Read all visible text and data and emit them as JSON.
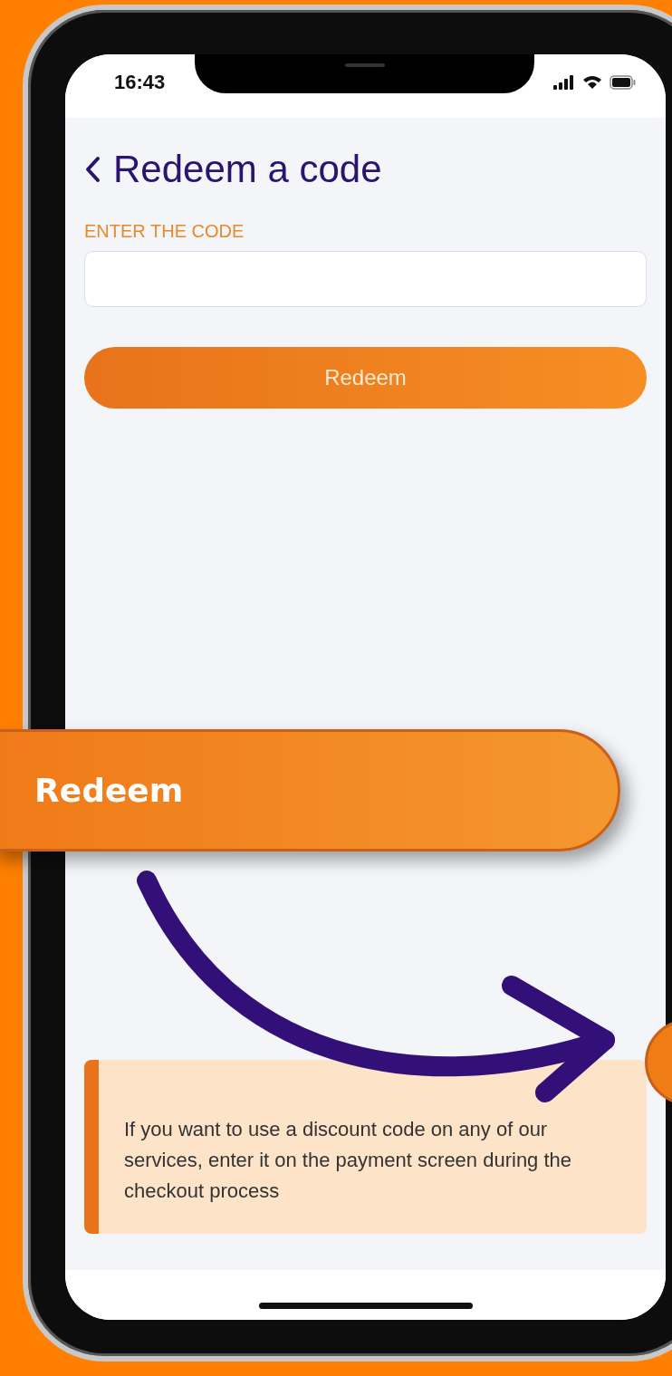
{
  "status_bar": {
    "time": "16:43"
  },
  "header": {
    "title": "Redeem a code"
  },
  "code_field": {
    "label": "ENTER THE CODE"
  },
  "redeem_button": {
    "label": "Redeem"
  },
  "info_box": {
    "text": "If you want to use a discount code on any of our services, enter it on the payment screen during the checkout process"
  },
  "callout": {
    "label": "Redeem"
  }
}
